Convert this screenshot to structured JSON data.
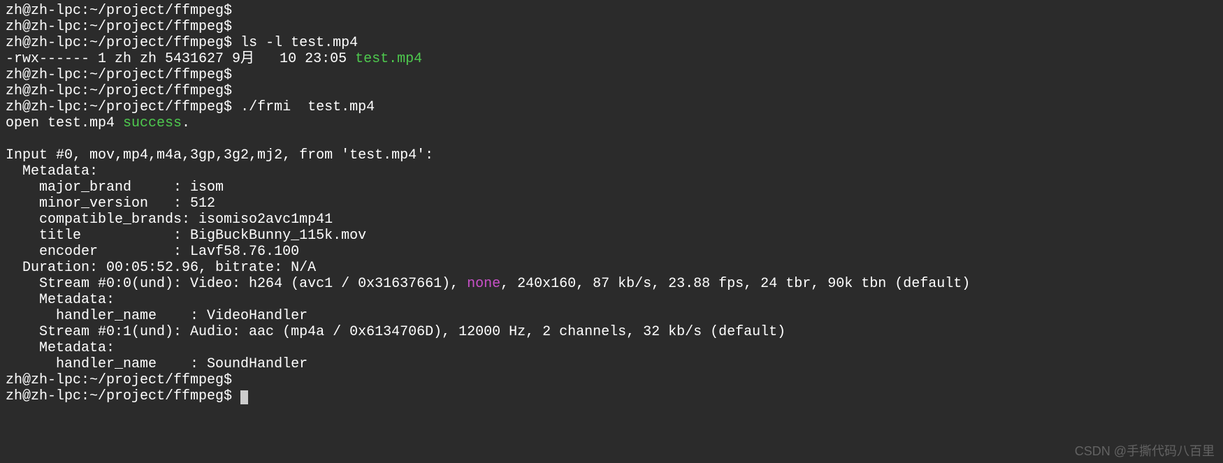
{
  "prompt": "zh@zh-lpc:~/project/ffmpeg$",
  "cmd_ls": " ls -l test.mp4",
  "ls_output_prefix": "-rwx------ 1 zh zh 5431627 9月   10 23:05 ",
  "ls_output_file": "test.mp4",
  "cmd_frmi": " ./frmi  test.mp4",
  "open_prefix": "open test.mp4 ",
  "open_success": "success",
  "open_suffix": ".",
  "blank": "",
  "input_line": "Input #0, mov,mp4,m4a,3gp,3g2,mj2, from 'test.mp4':",
  "meta_header": "  Metadata:",
  "meta_major": "    major_brand     : isom",
  "meta_minor": "    minor_version   : 512",
  "meta_compat": "    compatible_brands: isomiso2avc1mp41",
  "meta_title": "    title           : BigBuckBunny_115k.mov",
  "meta_encoder": "    encoder         : Lavf58.76.100",
  "duration": "  Duration: 00:05:52.96, bitrate: N/A",
  "stream0_prefix": "    Stream #0:0(und): Video: h264 (avc1 / 0x31637661), ",
  "stream0_none": "none",
  "stream0_suffix": ", 240x160, 87 kb/s, 23.88 fps, 24 tbr, 90k tbn (default)",
  "stream0_meta": "    Metadata:",
  "stream0_handler": "      handler_name    : VideoHandler",
  "stream1": "    Stream #0:1(und): Audio: aac (mp4a / 0x6134706D), 12000 Hz, 2 channels, 32 kb/s (default)",
  "stream1_meta": "    Metadata:",
  "stream1_handler": "      handler_name    : SoundHandler",
  "watermark": "CSDN @手撕代码八百里"
}
